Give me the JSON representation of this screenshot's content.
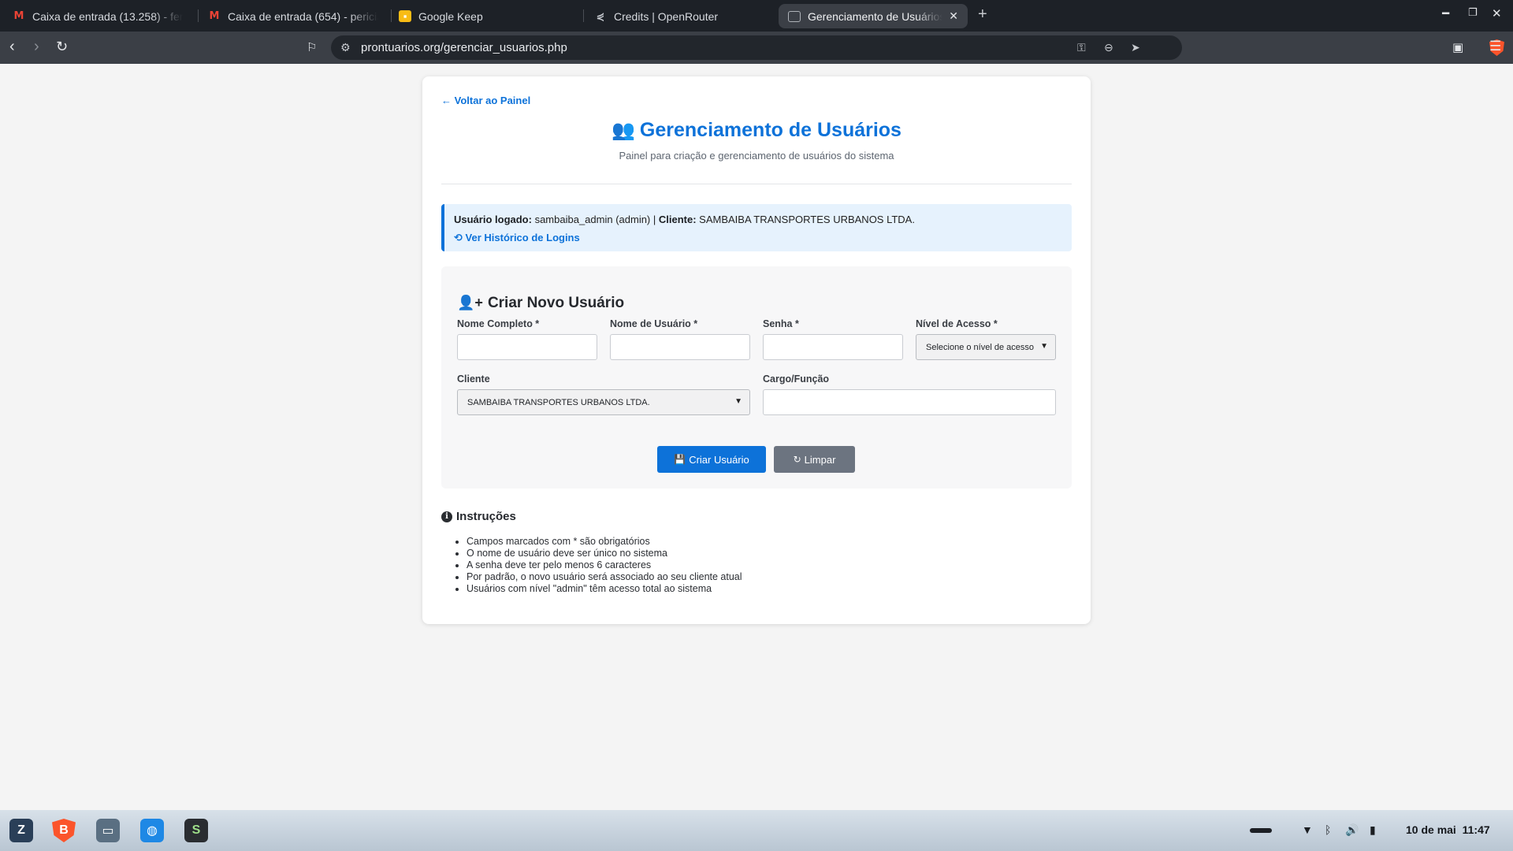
{
  "browser": {
    "tabs": [
      {
        "title": "Caixa de entrada (13.258) - fern",
        "icon": "gmail-icon"
      },
      {
        "title": "Caixa de entrada (654) - pericia",
        "icon": "gmail-icon"
      },
      {
        "title": "Google Keep",
        "icon": "google-keep-icon"
      },
      {
        "title": "Credits | OpenRouter",
        "icon": "openrouter-icon"
      },
      {
        "title": "Gerenciamento de Usuários",
        "icon": "globe-icon",
        "active": true
      }
    ],
    "url": "prontuarios.org/gerenciar_usuarios.php"
  },
  "page": {
    "back_link": "Voltar ao Painel",
    "title": "Gerenciamento de Usuários",
    "subtitle": "Painel para criação e gerenciamento de usuários do sistema",
    "info": {
      "user_label": "Usuário logado:",
      "user_value": "sambaiba_admin (admin) |",
      "client_label": "Cliente:",
      "client_value": "SAMBAIBA TRANSPORTES URBANOS LTDA.",
      "history_link": "Ver Histórico de Logins"
    },
    "form": {
      "title": "Criar Novo Usuário",
      "fields": {
        "full_name_label": "Nome Completo *",
        "username_label": "Nome de Usuário *",
        "password_label": "Senha *",
        "access_level_label": "Nível de Acesso *",
        "access_level_value": "Selecione o nível de acesso",
        "client_label": "Cliente",
        "client_value": "SAMBAIBA TRANSPORTES URBANOS LTDA.",
        "role_label": "Cargo/Função"
      },
      "create_button": "Criar Usuário",
      "clear_button": "Limpar"
    },
    "instructions": {
      "title": "Instruções",
      "items": [
        "Campos marcados com * são obrigatórios",
        "O nome de usuário deve ser único no sistema",
        "A senha deve ter pelo menos 6 caracteres",
        "Por padrão, o novo usuário será associado ao seu cliente atual",
        "Usuários com nível \"admin\" têm acesso total ao sistema"
      ]
    }
  },
  "taskbar": {
    "date": "10 de mai",
    "time": "11:47"
  },
  "colors": {
    "accent": "#0d72d9",
    "secondary_button": "#6c7480",
    "info_background": "#e6f2fd"
  }
}
